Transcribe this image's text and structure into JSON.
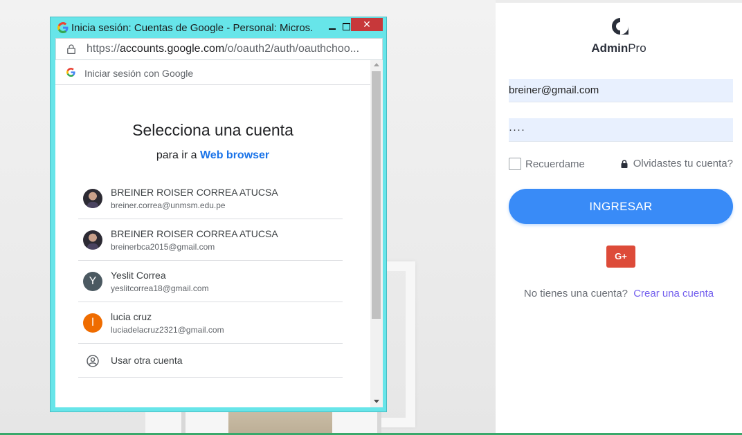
{
  "popup": {
    "title": "Inicia sesión: Cuentas de Google - Personal: Micros...",
    "close_label": "✕",
    "url_prefix": "https://",
    "url_host": "accounts.google.com",
    "url_path": "/o/oauth2/auth/oauthchoo...",
    "header_label": "Iniciar sesión con Google",
    "heading": "Selecciona una cuenta",
    "subheading": "para ir a",
    "subheading_link": "Web browser",
    "accounts": [
      {
        "name": "BREINER ROISER CORREA ATUCSA",
        "email": "breiner.correa@unmsm.edu.pe",
        "avatar": "photo"
      },
      {
        "name": "BREINER ROISER CORREA ATUCSA",
        "email": "breinerbca2015@gmail.com",
        "avatar": "photo"
      },
      {
        "name": "Yeslit Correa",
        "email": "yeslitcorrea18@gmail.com",
        "avatar": "Y",
        "avatar_color": "#4b5961"
      },
      {
        "name": "lucia cruz",
        "email": "luciadelacruz2321@gmail.com",
        "avatar": "l",
        "avatar_color": "#ef6c00"
      }
    ],
    "other_account": "Usar otra cuenta"
  },
  "login": {
    "brand_bold": "Admin",
    "brand_rest": "Pro",
    "email_value": "breiner@gmail.com",
    "password_value": "····",
    "remember_label": "Recuerdame",
    "forgot_label": "Olvidastes tu cuenta?",
    "submit_label": "INGRESAR",
    "gplus_label": "G+",
    "signup_text": "No tienes una cuenta?",
    "signup_link": "Crear una cuenta",
    "accent": "#398bf7",
    "gplus_color": "#dd4b39"
  }
}
